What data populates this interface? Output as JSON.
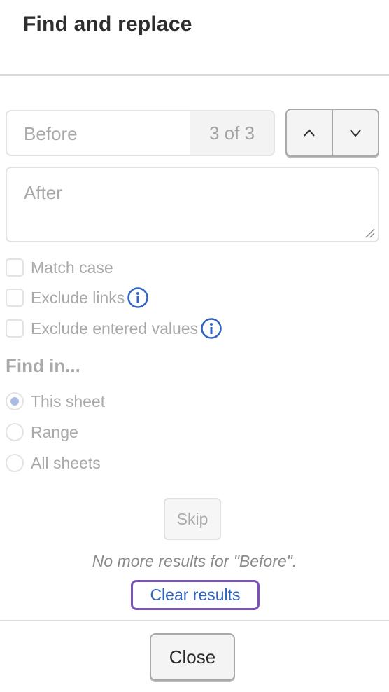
{
  "dialog": {
    "title": "Find and replace"
  },
  "find": {
    "placeholder": "Before",
    "value": "",
    "count": "3 of 3"
  },
  "nav": {
    "prev_icon": "chevron-up-icon",
    "next_icon": "chevron-down-icon"
  },
  "replace": {
    "placeholder": "After",
    "value": ""
  },
  "options": [
    {
      "label": "Match case",
      "checked": false,
      "info": false
    },
    {
      "label": "Exclude links",
      "checked": false,
      "info": true
    },
    {
      "label": "Exclude entered values",
      "checked": false,
      "info": true
    }
  ],
  "find_in": {
    "heading": "Find in...",
    "choices": [
      {
        "label": "This sheet",
        "selected": true
      },
      {
        "label": "Range",
        "selected": false
      },
      {
        "label": "All sheets",
        "selected": false
      }
    ]
  },
  "actions": {
    "skip_label": "Skip",
    "status_message": "No more results for \"Before\".",
    "clear_results_label": "Clear results"
  },
  "footer": {
    "close_label": "Close"
  },
  "colors": {
    "link": "#2f63c4",
    "focus_ring": "#7b52b9",
    "info_icon": "#2f63c4",
    "radio_selected": "#a9bde4"
  }
}
